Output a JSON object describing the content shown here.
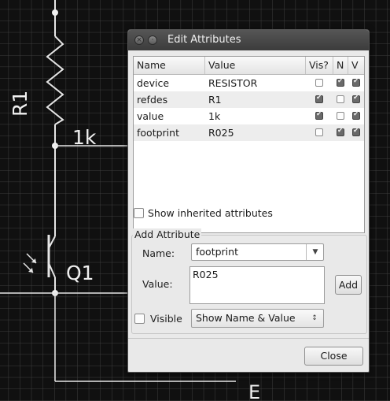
{
  "schematic": {
    "resistor_refdes": "R1",
    "resistor_value": "1k",
    "transistor_refdes": "Q1",
    "bottom_label": "E"
  },
  "dialog": {
    "title": "Edit Attributes",
    "table": {
      "headers": [
        "Name",
        "Value",
        "Vis?",
        "N",
        "V"
      ],
      "rows": [
        {
          "name": "device",
          "value": "RESISTOR",
          "vis": false,
          "n": true,
          "v": true
        },
        {
          "name": "refdes",
          "value": "R1",
          "vis": true,
          "n": false,
          "v": true
        },
        {
          "name": "value",
          "value": "1k",
          "vis": true,
          "n": false,
          "v": true
        },
        {
          "name": "footprint",
          "value": "R025",
          "vis": false,
          "n": true,
          "v": true
        }
      ]
    },
    "show_inherited_label": "Show inherited attributes",
    "add_attribute": {
      "group_title": "Add Attribute",
      "name_label": "Name:",
      "name_value": "footprint",
      "value_label": "Value:",
      "value_text": "R025",
      "add_button": "Add",
      "visible_label": "Visible",
      "visibility_mode": "Show Name & Value"
    },
    "close_button": "Close"
  }
}
